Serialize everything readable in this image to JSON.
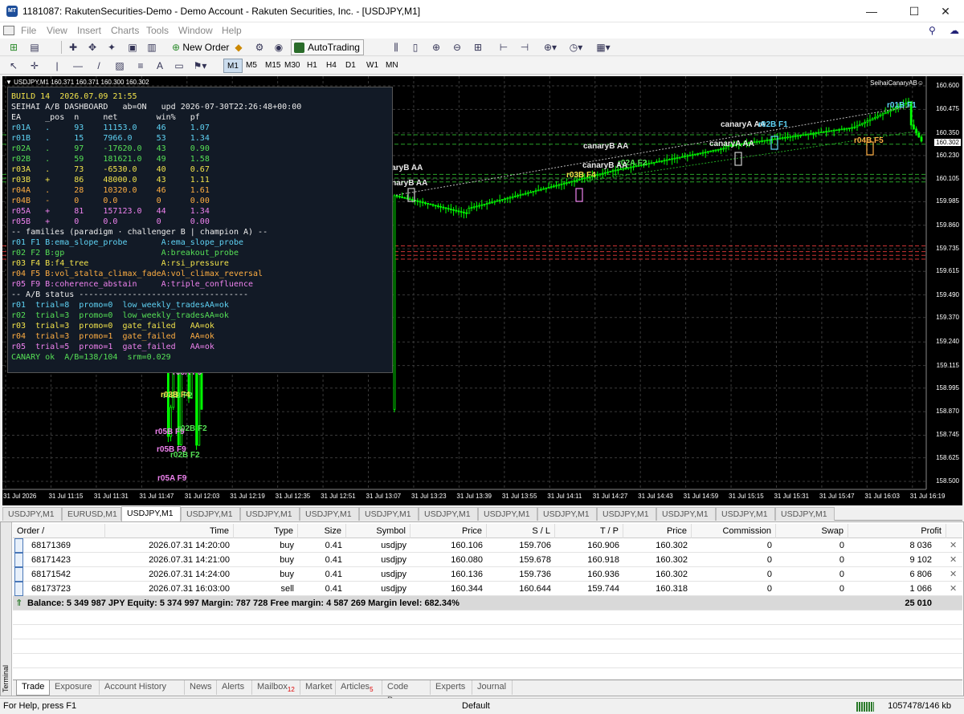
{
  "window": {
    "title": "1181087: RakutenSecurities-Demo - Demo Account - Rakuten Securities, Inc. - [USDJPY,M1]",
    "controls": [
      "—",
      "☐",
      "✕"
    ]
  },
  "menu": [
    "File",
    "View",
    "Insert",
    "Charts",
    "Tools",
    "Window",
    "Help"
  ],
  "toolbar": {
    "new_order": "New Order",
    "autotrading": "AutoTrading",
    "timeframes": [
      "M1",
      "M5",
      "M15",
      "M30",
      "H1",
      "H4",
      "D1",
      "W1",
      "MN"
    ],
    "selected_timeframe": "M1"
  },
  "chart": {
    "info": "▼ USDJPY,M1  160.371 160.371 160.300 160.302",
    "ea_name": "SeihaiCanaryAB☺",
    "current_price": "160.302",
    "price_axis": [
      "160.600",
      "160.475",
      "160.350",
      "160.230",
      "160.105",
      "159.985",
      "159.860",
      "159.735",
      "159.615",
      "159.490",
      "159.370",
      "159.240",
      "159.115",
      "158.995",
      "158.870",
      "158.745",
      "158.625",
      "158.500"
    ],
    "time_axis": [
      "31 Jul 2026",
      "31 Jul 11:15",
      "31 Jul 11:31",
      "31 Jul 11:47",
      "31 Jul 12:03",
      "31 Jul 12:19",
      "31 Jul 12:35",
      "31 Jul 12:51",
      "31 Jul 13:07",
      "31 Jul 13:23",
      "31 Jul 13:39",
      "31 Jul 13:55",
      "31 Jul 14:11",
      "31 Jul 14:27",
      "31 Jul 14:43",
      "31 Jul 14:59",
      "31 Jul 15:15",
      "31 Jul 15:31",
      "31 Jul 15:47",
      "31 Jul 16:03",
      "31 Jul 16:19"
    ],
    "markers": [
      {
        "text": "r01B F1",
        "color": "#5fd3f5"
      },
      {
        "text": "canaryA AA",
        "color": "#e8e8e8"
      },
      {
        "text": "r02B F1",
        "color": "#5fd3f5"
      },
      {
        "text": "canaryA AA",
        "color": "#e8e8e8"
      },
      {
        "text": "r04B F5",
        "color": "#ffae42"
      },
      {
        "text": "canaryB AA",
        "color": "#e8e8e8"
      },
      {
        "text": "canaryB AA",
        "color": "#e8e8e8"
      },
      {
        "text": "r02A F2",
        "color": "#56e056"
      },
      {
        "text": "r03B F4",
        "color": "#f2e34b"
      },
      {
        "text": "canaryB AA",
        "color": "#e8e8e8"
      },
      {
        "text": "canaryB AA",
        "color": "#e8e8e8"
      },
      {
        "text": "r05A F9",
        "color": "#ee82ee"
      },
      {
        "text": "r03B F4",
        "color": "#f2e34b"
      },
      {
        "text": "r02B F2",
        "color": "#56e056"
      },
      {
        "text": "r05A F9",
        "color": "#ee82ee"
      },
      {
        "text": "r05B F9",
        "color": "#ee82ee"
      },
      {
        "text": "r04A F5",
        "color": "#ffae42"
      },
      {
        "text": "r03B F4",
        "color": "#f2e34b"
      },
      {
        "text": "r02B F2",
        "color": "#56e056"
      },
      {
        "text": "r03B F4",
        "color": "#f2e34b"
      },
      {
        "text": "r02B F2",
        "color": "#56e056"
      },
      {
        "text": "r03B F4",
        "color": "#f2e34b"
      },
      {
        "text": "r05A F9",
        "color": "#ee82ee"
      },
      {
        "text": "r05A F9",
        "color": "#ee82ee"
      },
      {
        "text": "r05A F9",
        "color": "#ee82ee"
      },
      {
        "text": "r05B F9",
        "color": "#ee82ee"
      },
      {
        "text": "r05A F9",
        "color": "#ee82ee"
      },
      {
        "text": "r05A F9",
        "color": "#ee82ee"
      },
      {
        "text": "r05A F9",
        "color": "#ee82ee"
      },
      {
        "text": "r02B F2",
        "color": "#56e056"
      },
      {
        "text": "r05B F9",
        "color": "#ee82ee"
      },
      {
        "text": "r05A F9",
        "color": "#ee82ee"
      },
      {
        "text": "r02B F2",
        "color": "#56e056"
      },
      {
        "text": "r03B F4",
        "color": "#f2e34b"
      },
      {
        "text": "r05B F9",
        "color": "#ee82ee"
      },
      {
        "text": "r02B F2",
        "color": "#56e056"
      },
      {
        "text": "r05B F9",
        "color": "#ee82ee"
      },
      {
        "text": "r02B F2",
        "color": "#56e056"
      },
      {
        "text": "r05A F9",
        "color": "#ee82ee"
      }
    ]
  },
  "dashboard": {
    "lines": [
      {
        "t": "BUILD 14  2026.07.09 21:55",
        "c": "c-yellow"
      },
      {
        "t": "SEIHAI A/B DASHBOARD   ab=ON   upd 2026-07-30T22:26:48+00:00",
        "c": "c-white"
      },
      {
        "t": "EA     _pos  n     net        win%   pf",
        "c": "c-white"
      },
      {
        "t": "r01A   .     93    11153.0    46     1.07",
        "c": "c-cyan"
      },
      {
        "t": "r01B   .     15    7966.0     53     1.34",
        "c": "c-cyan"
      },
      {
        "t": "r02A   .     97    -17620.0   43     0.90",
        "c": "c-green"
      },
      {
        "t": "r02B   .     59    181621.0   49     1.58",
        "c": "c-green"
      },
      {
        "t": "r03A   .     73    -6530.0    40     0.67",
        "c": "c-yellow"
      },
      {
        "t": "r03B   +     86    48000.0    43     1.11",
        "c": "c-yellow"
      },
      {
        "t": "r04A   .     28    10320.0    46     1.61",
        "c": "c-orange"
      },
      {
        "t": "r04B   -     0     0.0        0      0.00",
        "c": "c-orange"
      },
      {
        "t": "r05A   +     81    157123.0   44     1.34",
        "c": "c-violet"
      },
      {
        "t": "r05B   +     0     0.0        0      0.00",
        "c": "c-violet"
      },
      {
        "t": "-- families (paradigm · challenger B | champion A) --",
        "c": "c-white"
      },
      {
        "t": "r01 F1 B:ema_slope_probe       A:ema_slope_probe",
        "c": "c-cyan"
      },
      {
        "t": "r02 F2 B:gp                    A:breakout_probe",
        "c": "c-green"
      },
      {
        "t": "r03 F4 B:f4_tree               A:rsi_pressure",
        "c": "c-yellow"
      },
      {
        "t": "r04 F5 B:vol_stalta_climax_fadeA:vol_climax_reversal",
        "c": "c-orange"
      },
      {
        "t": "r05 F9 B:coherence_abstain     A:triple_confluence",
        "c": "c-violet"
      },
      {
        "t": "-- A/B status -----------------------------------",
        "c": "c-white"
      },
      {
        "t": "r01  trial=8  promo=0  low_weekly_tradesAA=ok",
        "c": "c-cyan"
      },
      {
        "t": "r02  trial=3  promo=0  low_weekly_tradesAA=ok",
        "c": "c-green"
      },
      {
        "t": "r03  trial=3  promo=0  gate_failed   AA=ok",
        "c": "c-yellow"
      },
      {
        "t": "r04  trial=3  promo=1  gate_failed   AA=ok",
        "c": "c-orange"
      },
      {
        "t": "r05  trial=5  promo=1  gate_failed   AA=ok",
        "c": "c-violet"
      },
      {
        "t": "CANARY ok  A/B=138/104  srm=0.029",
        "c": "c-green"
      }
    ]
  },
  "chart_tabs": {
    "items": [
      "USDJPY,M1",
      "EURUSD,M1",
      "USDJPY,M1",
      "USDJPY,M1",
      "USDJPY,M1",
      "USDJPY,M1",
      "USDJPY,M1",
      "USDJPY,M1",
      "USDJPY,M1",
      "USDJPY,M1",
      "USDJPY,M1",
      "USDJPY,M1",
      "USDJPY,M1",
      "USDJPY,M1"
    ],
    "active_index": 2
  },
  "terminal": {
    "side_label": "Terminal",
    "columns": [
      "Order  /",
      "Time",
      "Type",
      "Size",
      "Symbol",
      "Price",
      "S / L",
      "T / P",
      "Price",
      "Commission",
      "Swap",
      "Profit"
    ],
    "rows": [
      [
        "68171369",
        "2026.07.31 14:20:00",
        "buy",
        "0.41",
        "usdjpy",
        "160.106",
        "159.706",
        "160.906",
        "160.302",
        "0",
        "0",
        "8 036"
      ],
      [
        "68171423",
        "2026.07.31 14:21:00",
        "buy",
        "0.41",
        "usdjpy",
        "160.080",
        "159.678",
        "160.918",
        "160.302",
        "0",
        "0",
        "9 102"
      ],
      [
        "68171542",
        "2026.07.31 14:24:00",
        "buy",
        "0.41",
        "usdjpy",
        "160.136",
        "159.736",
        "160.936",
        "160.302",
        "0",
        "0",
        "6 806"
      ],
      [
        "68173723",
        "2026.07.31 16:03:00",
        "sell",
        "0.41",
        "usdjpy",
        "160.344",
        "160.644",
        "159.744",
        "160.318",
        "0",
        "0",
        "1 066"
      ]
    ],
    "balance_text": "Balance: 5 349 987 JPY  Equity: 5 374 997  Margin: 787 728  Free margin: 4 587 269  Margin level: 682.34%",
    "balance_profit": "25 010",
    "tabs": [
      {
        "label": "Trade",
        "badge": ""
      },
      {
        "label": "Exposure",
        "badge": ""
      },
      {
        "label": "Account History",
        "badge": ""
      },
      {
        "label": "News",
        "badge": ""
      },
      {
        "label": "Alerts",
        "badge": ""
      },
      {
        "label": "Mailbox",
        "badge": "12"
      },
      {
        "label": "Market",
        "badge": ""
      },
      {
        "label": "Articles",
        "badge": "5"
      },
      {
        "label": "Code Base",
        "badge": ""
      },
      {
        "label": "Experts",
        "badge": ""
      },
      {
        "label": "Journal",
        "badge": ""
      }
    ],
    "active_tab": "Trade"
  },
  "status": {
    "help": "For Help, press F1",
    "profile": "Default",
    "traffic": "1057478/146 kb"
  },
  "colors": {
    "chart_bg": "#000000",
    "candle_bull": "#00ff00",
    "grid": "#3a3a3a",
    "dash_bg": "#121a26"
  }
}
